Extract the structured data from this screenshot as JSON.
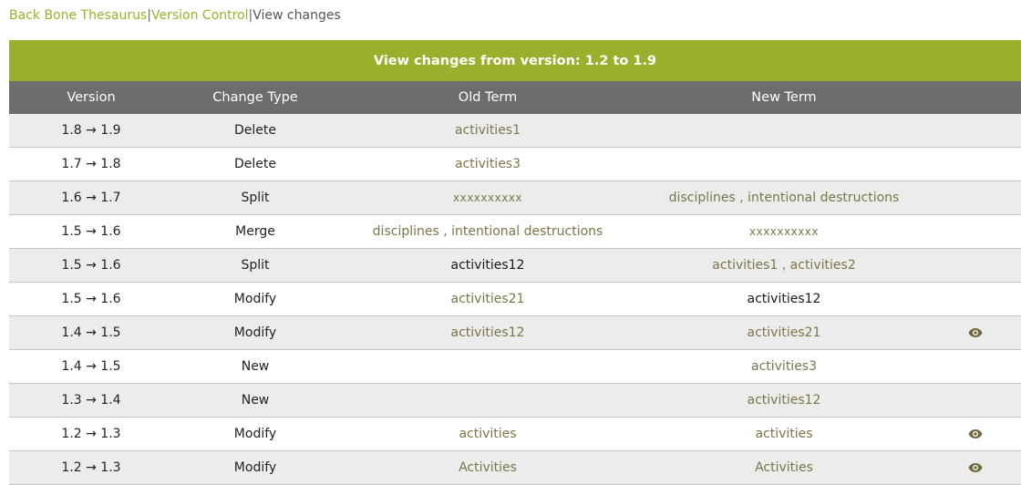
{
  "breadcrumb": {
    "item1": "Back Bone Thesaurus",
    "sep": "|",
    "item2": "Version Control",
    "item3": "View changes"
  },
  "table": {
    "title": "View changes from version: 1.2 to 1.9",
    "headers": {
      "version": "Version",
      "change_type": "Change Type",
      "old_term": "Old Term",
      "new_term": "New Term"
    },
    "rows": [
      {
        "version": "1.8 → 1.9",
        "change_type": "Delete",
        "old_term": "activities1",
        "new_term": "",
        "has_view": false
      },
      {
        "version": "1.7 → 1.8",
        "change_type": "Delete",
        "old_term": "activities3",
        "new_term": "",
        "has_view": false
      },
      {
        "version": "1.6 → 1.7",
        "change_type": "Split",
        "old_term": "xxxxxxxxxx",
        "new_term": "disciplines , intentional destructions",
        "has_view": false
      },
      {
        "version": "1.5 → 1.6",
        "change_type": "Merge",
        "old_term": "disciplines , intentional destructions",
        "new_term": "xxxxxxxxxx",
        "has_view": false
      },
      {
        "version": "1.5 → 1.6",
        "change_type": "Split",
        "old_term": "activities12",
        "new_term": "activities1 , activities2",
        "has_view": false
      },
      {
        "version": "1.5 → 1.6",
        "change_type": "Modify",
        "old_term": "activities21",
        "new_term": "activities12",
        "has_view": false
      },
      {
        "version": "1.4 → 1.5",
        "change_type": "Modify",
        "old_term": "activities12",
        "new_term": "activities21",
        "has_view": true
      },
      {
        "version": "1.4 → 1.5",
        "change_type": "New",
        "old_term": "",
        "new_term": "activities3",
        "has_view": false
      },
      {
        "version": "1.3 → 1.4",
        "change_type": "New",
        "old_term": "",
        "new_term": "activities12",
        "has_view": false
      },
      {
        "version": "1.2 → 1.3",
        "change_type": "Modify",
        "old_term": "activities",
        "new_term": "activities",
        "has_view": true
      },
      {
        "version": "1.2 → 1.3",
        "change_type": "Modify",
        "old_term": "Activities",
        "new_term": "Activities",
        "has_view": true
      }
    ]
  },
  "icons": {
    "view": "eye-icon"
  },
  "colors": {
    "accent": "#9caf2c",
    "header_gray": "#6d6d6d",
    "row_alt": "#ececec",
    "term_text": "#7a7648"
  }
}
